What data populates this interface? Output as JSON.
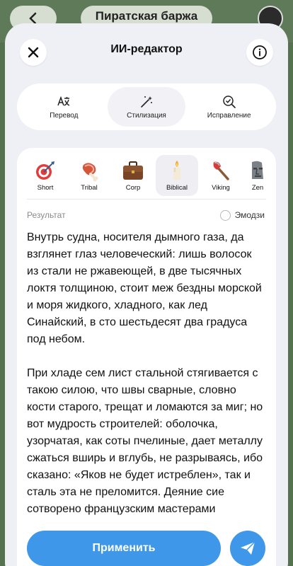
{
  "background_chat": {
    "title": "Пиратская баржа"
  },
  "sheet": {
    "title": "ИИ-редактор"
  },
  "tabs": [
    {
      "label": "Перевод",
      "icon": "translate-icon"
    },
    {
      "label": "Стилизация",
      "icon": "magic-wand-icon",
      "active": true
    },
    {
      "label": "Исправление",
      "icon": "check-search-icon"
    }
  ],
  "styles": [
    {
      "label": "Short",
      "icon": "target-dart-icon"
    },
    {
      "label": "Tribal",
      "icon": "meat-icon"
    },
    {
      "label": "Corp",
      "icon": "briefcase-icon"
    },
    {
      "label": "Biblical",
      "icon": "candle-icon",
      "active": true
    },
    {
      "label": "Viking",
      "icon": "axe-icon"
    },
    {
      "label": "Zen",
      "icon": "moai-icon"
    }
  ],
  "result": {
    "label": "Результат",
    "emoji_label": "Эмодзи",
    "paragraphs": [
      "Внутрь судна, носителя дымного газа, да взглянет глаз человеческий: лишь волосок из стали не ржавеющей, в две тысячных локтя толщиною, стоит меж бездны морской и моря жидкого, хладного, как лед Синайский, в сто шестьдесят два градуса под небом.",
      "При хладе сем лист стальной стягивается с такою силою, что швы сварные, словно кости старого, трещат и ломаются за миг; но вот мудрость строителей: оболочка, узорчатая, как соты пчелиные, дает металлу сжаться вширь и вглубь, не разрываясь, ибо сказано: «Яков не будет истреблен», так и сталь эта не преломится. Деяние сие сотворено французским мастерами"
    ]
  },
  "apply_label": "Применить",
  "colors": {
    "accent": "#3e97e9",
    "sheet_bg": "#eff0f5",
    "chat_bg": "#56714f"
  }
}
